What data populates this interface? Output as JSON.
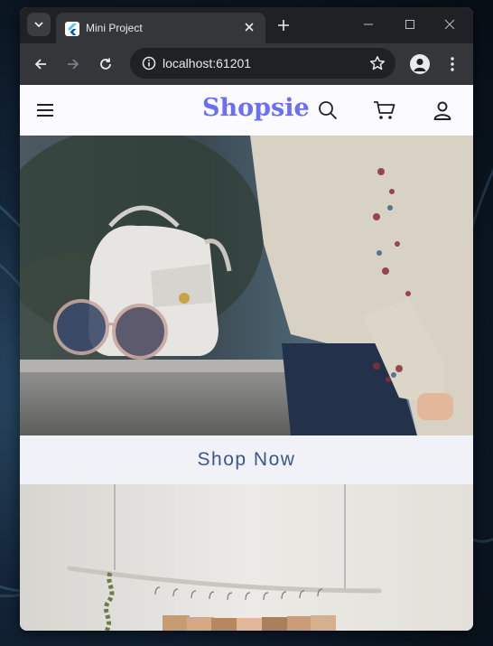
{
  "browser": {
    "tab": {
      "title": "Mini Project"
    },
    "address": {
      "url": "localhost:61201"
    }
  },
  "app": {
    "brand": "Shopsie",
    "brand_color": "#6a6ff5",
    "icons": [
      "menu-icon",
      "search-icon",
      "cart-icon",
      "account-icon"
    ],
    "hero": {
      "image": "woman-with-white-handbag-and-sunglasses-photo"
    },
    "cta": {
      "label": "Shop Now"
    },
    "second_banner": {
      "image": "clothing-rack-with-hangers-photo"
    }
  }
}
